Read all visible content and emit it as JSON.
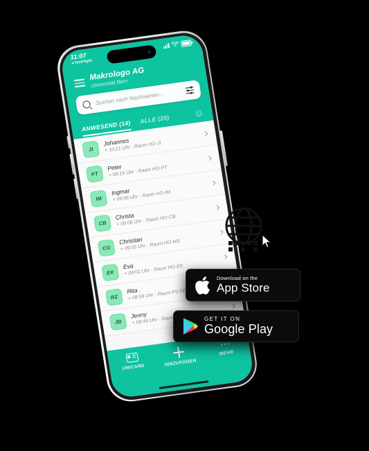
{
  "app": {
    "statusbar": {
      "time": "11:07",
      "back_app": "◂ TestFlight",
      "signal_icon": "signal-bars-icon",
      "wifi_icon": "wifi-icon",
      "battery_icon": "battery-icon"
    },
    "header": {
      "menu_icon": "hamburger-menu-icon",
      "title": "Makrologo AG",
      "subtitle": "Universität Bern"
    },
    "search": {
      "icon": "search-icon",
      "placeholder": "Suchen nach Nachnamen...",
      "value": "",
      "filter_icon": "filter-sliders-icon"
    },
    "tabs": [
      {
        "label": "ANWESEND (14)",
        "active": true
      },
      {
        "label": "ALLE (20)",
        "active": false
      }
    ],
    "refresh_icon": "loading-spinner-icon",
    "list": [
      {
        "initials": "JI",
        "name": "Johannes",
        "detail": "+ 10:21 Uhr - Raum HO-JI"
      },
      {
        "initials": "PT",
        "name": "Peter",
        "detail": "+ 09:16 Uhr - Raum HO-PT"
      },
      {
        "initials": "IM",
        "name": "Ingmar",
        "detail": "+ 09:06 Uhr - Raum HO-IM"
      },
      {
        "initials": "CB",
        "name": "Christa",
        "detail": "+ 09:06 Uhr - Raum HO-CB"
      },
      {
        "initials": "CG",
        "name": "Christian",
        "detail": "+ 09:05 Uhr - Raum HO-MS"
      },
      {
        "initials": "EK",
        "name": "Eva",
        "detail": "+ 09:01 Uhr - Raum HO-EK"
      },
      {
        "initials": "RZ",
        "name": "Rita .",
        "detail": "+ 08:59 Uhr - Raum PS-DF"
      },
      {
        "initials": "JB",
        "name": "Jenny",
        "detail": "+ 08:49 Uhr - Raum HO-JenB"
      }
    ],
    "tabbar": [
      {
        "label": "UNICARD",
        "icon": "id-card-icon"
      },
      {
        "label": "HINZUFÜGEN",
        "icon": "plus-icon"
      },
      {
        "label": "MEHR",
        "icon": "more-dots-icon"
      }
    ]
  },
  "badges": {
    "appstore": {
      "icon": "apple-logo-icon",
      "small": "Download on the",
      "big": "App Store"
    },
    "googleplay": {
      "icon": "google-play-icon",
      "small": "GET IT ON",
      "big": "Google Play"
    }
  },
  "graphics": {
    "logo": "qr-globe-logo-icon",
    "cursor": "mouse-cursor-icon"
  },
  "colors": {
    "brand_teal": "#0ec3a0",
    "avatar_green": "#8ae9b8",
    "background": "#000000",
    "badge_black": "#0b0b0b"
  }
}
